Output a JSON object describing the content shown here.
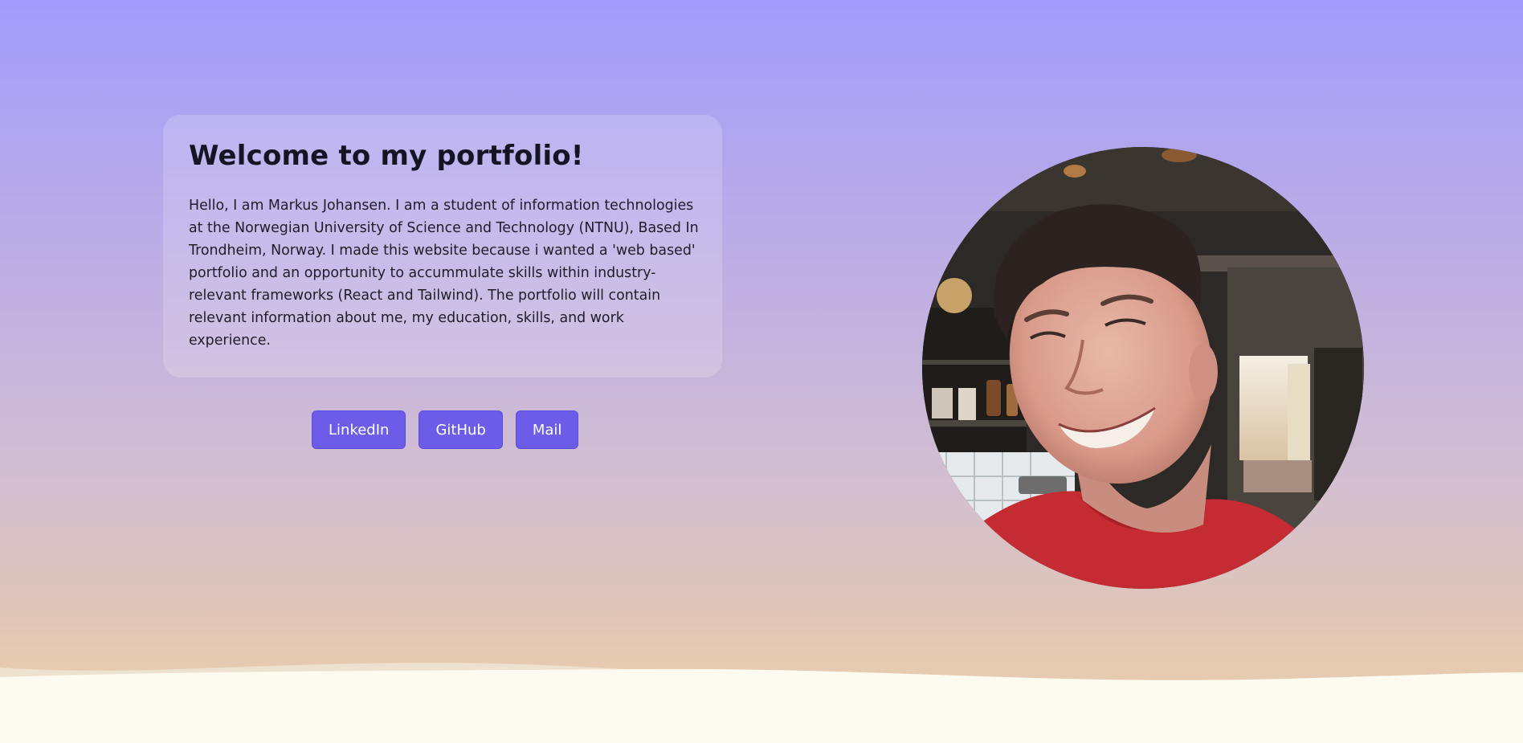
{
  "hero": {
    "title": "Welcome to my portfolio!",
    "description": "Hello, I am Markus Johansen. I am a student of information technologies at the Norwegian University of Science and Technology (NTNU), Based In Trondheim, Norway. I made this website because i wanted a 'web based' portfolio and an opportunity to accummulate skills within industry-relevant frameworks (React and Tailwind). The portfolio will contain relevant information about me, my education, skills, and work experience."
  },
  "links": {
    "linkedin_label": "LinkedIn",
    "github_label": "GitHub",
    "mail_label": "Mail"
  },
  "colors": {
    "gradient_top": "#a39cfc",
    "gradient_bottom": "#e6cbb0",
    "button_bg": "#6c5ce7",
    "footer_wave": "#fdfaf0"
  }
}
